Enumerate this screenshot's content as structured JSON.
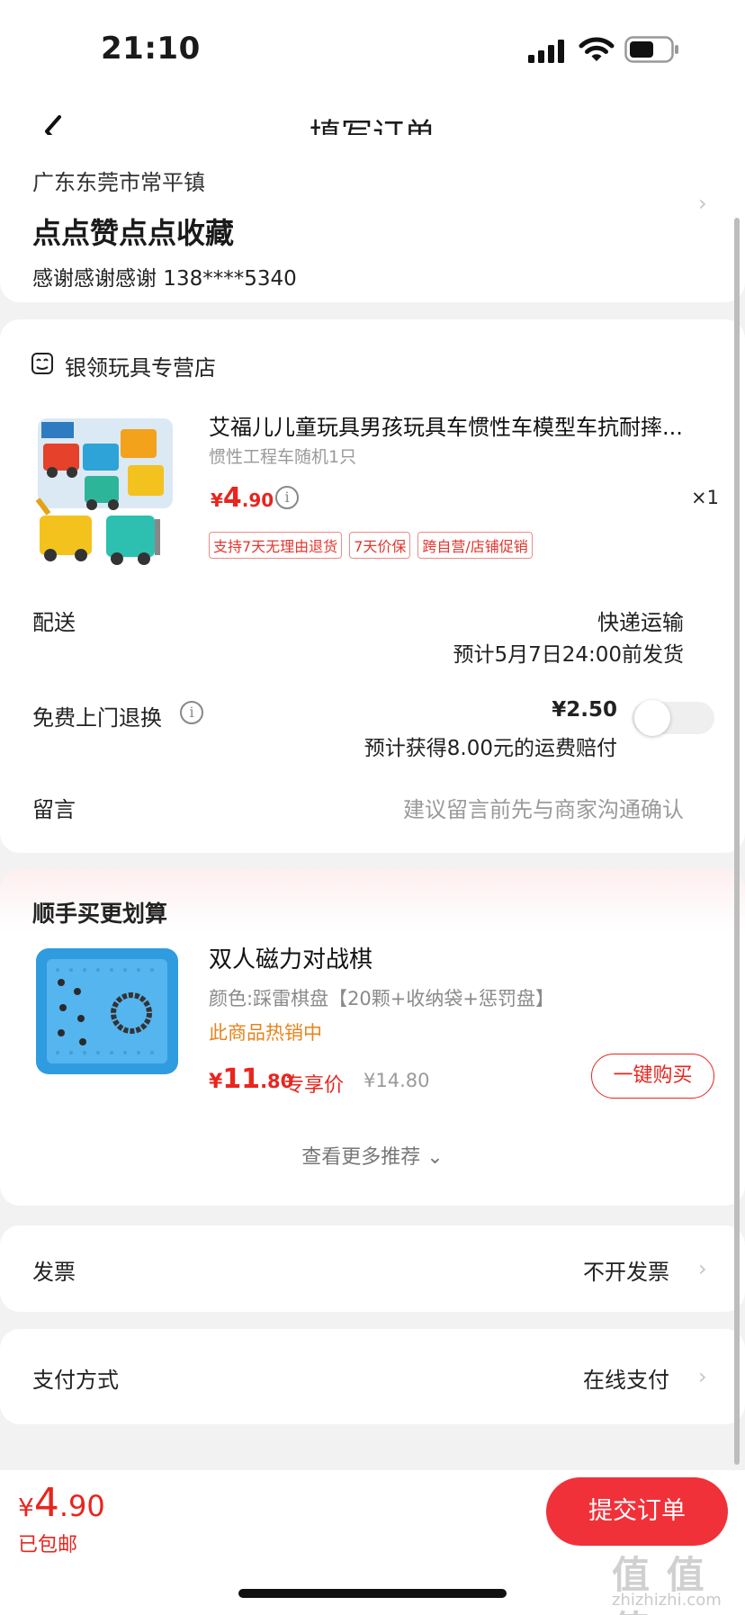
{
  "status": {
    "time": "21:10"
  },
  "nav": {
    "title": "填写订单"
  },
  "address": {
    "region": "广东东莞市常平镇",
    "name": "点点赞点点收藏",
    "contact": "感谢感谢感谢  138****5340"
  },
  "store": {
    "name": "银领玩具专营店"
  },
  "product": {
    "title": "艾福儿儿童玩具男孩玩具车惯性车模型车抗耐摔...",
    "spec": "惯性工程车随机1只",
    "price_yen": "¥",
    "price_int": "4",
    "price_dec": ".90",
    "info_icon": "i",
    "qty": "×1",
    "tags": [
      "支持7天无理由退货",
      "7天价保",
      "跨自营/店铺促销"
    ]
  },
  "shipping": {
    "label": "配送",
    "method": "快递运输",
    "eta": "预计5月7日24:00前发货"
  },
  "return_service": {
    "label": "免费上门退换",
    "price": "¥2.50",
    "note": "预计获得8.00元的运费赔付",
    "enabled": false
  },
  "message": {
    "label": "留言",
    "placeholder": "建议留言前先与商家沟通确认"
  },
  "recommend": {
    "title": "顺手买更划算",
    "name": "双人磁力对战棋",
    "spec": "颜色:踩雷棋盘【20颗+收纳袋+惩罚盘】",
    "hot": "此商品热销中",
    "price_yen": "¥",
    "price_int": "11",
    "price_dec": ".80",
    "exclusive": "专享价",
    "original": "¥14.80",
    "buy_label": "一键购买",
    "more_label": "查看更多推荐 ⌄"
  },
  "invoice": {
    "label": "发票",
    "value": "不开发票"
  },
  "payment": {
    "label": "支付方式",
    "value": "在线支付"
  },
  "footer": {
    "total_yen": "¥",
    "total_int": "4",
    "total_dec": ".90",
    "shipping_note": "已包邮",
    "submit_label": "提交订单"
  },
  "watermark": {
    "text": "值 值 值",
    "sub": "zhizhizhi.com"
  },
  "colors": {
    "accent": "#e8251e",
    "button": "#f0313a",
    "hot": "#e7841c"
  }
}
